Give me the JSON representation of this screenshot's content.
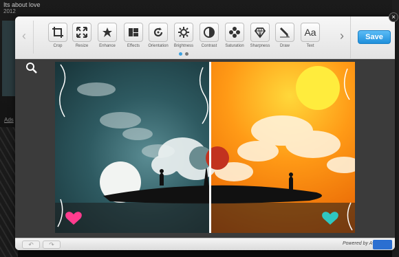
{
  "background_page": {
    "title": "Its about love",
    "year": "2012",
    "ads_link": "Ads"
  },
  "toolbar": {
    "tools": [
      {
        "label": "Crop",
        "icon": "crop-icon"
      },
      {
        "label": "Resize",
        "icon": "resize-icon"
      },
      {
        "label": "Enhance",
        "icon": "enhance-icon"
      },
      {
        "label": "Effects",
        "icon": "effects-icon"
      },
      {
        "label": "Orientation",
        "icon": "orientation-icon"
      },
      {
        "label": "Brightness",
        "icon": "brightness-icon"
      },
      {
        "label": "Contrast",
        "icon": "contrast-icon"
      },
      {
        "label": "Saturation",
        "icon": "saturation-icon"
      },
      {
        "label": "Sharpness",
        "icon": "sharpness-icon"
      },
      {
        "label": "Draw",
        "icon": "draw-icon"
      },
      {
        "label": "Text",
        "icon": "text-icon",
        "glyph": "Aa"
      }
    ],
    "save_label": "Save",
    "close_glyph": "×",
    "prev_glyph": "‹",
    "next_glyph": "›"
  },
  "footer": {
    "undo_glyph": "↶",
    "redo_glyph": "↷",
    "powered_by": "Powered by Aviary"
  },
  "colors": {
    "accent": "#2a97e2",
    "active_dot": "#3ba1e0",
    "sky_left": "#2e5a61",
    "sky_right": "#ff9a16"
  }
}
